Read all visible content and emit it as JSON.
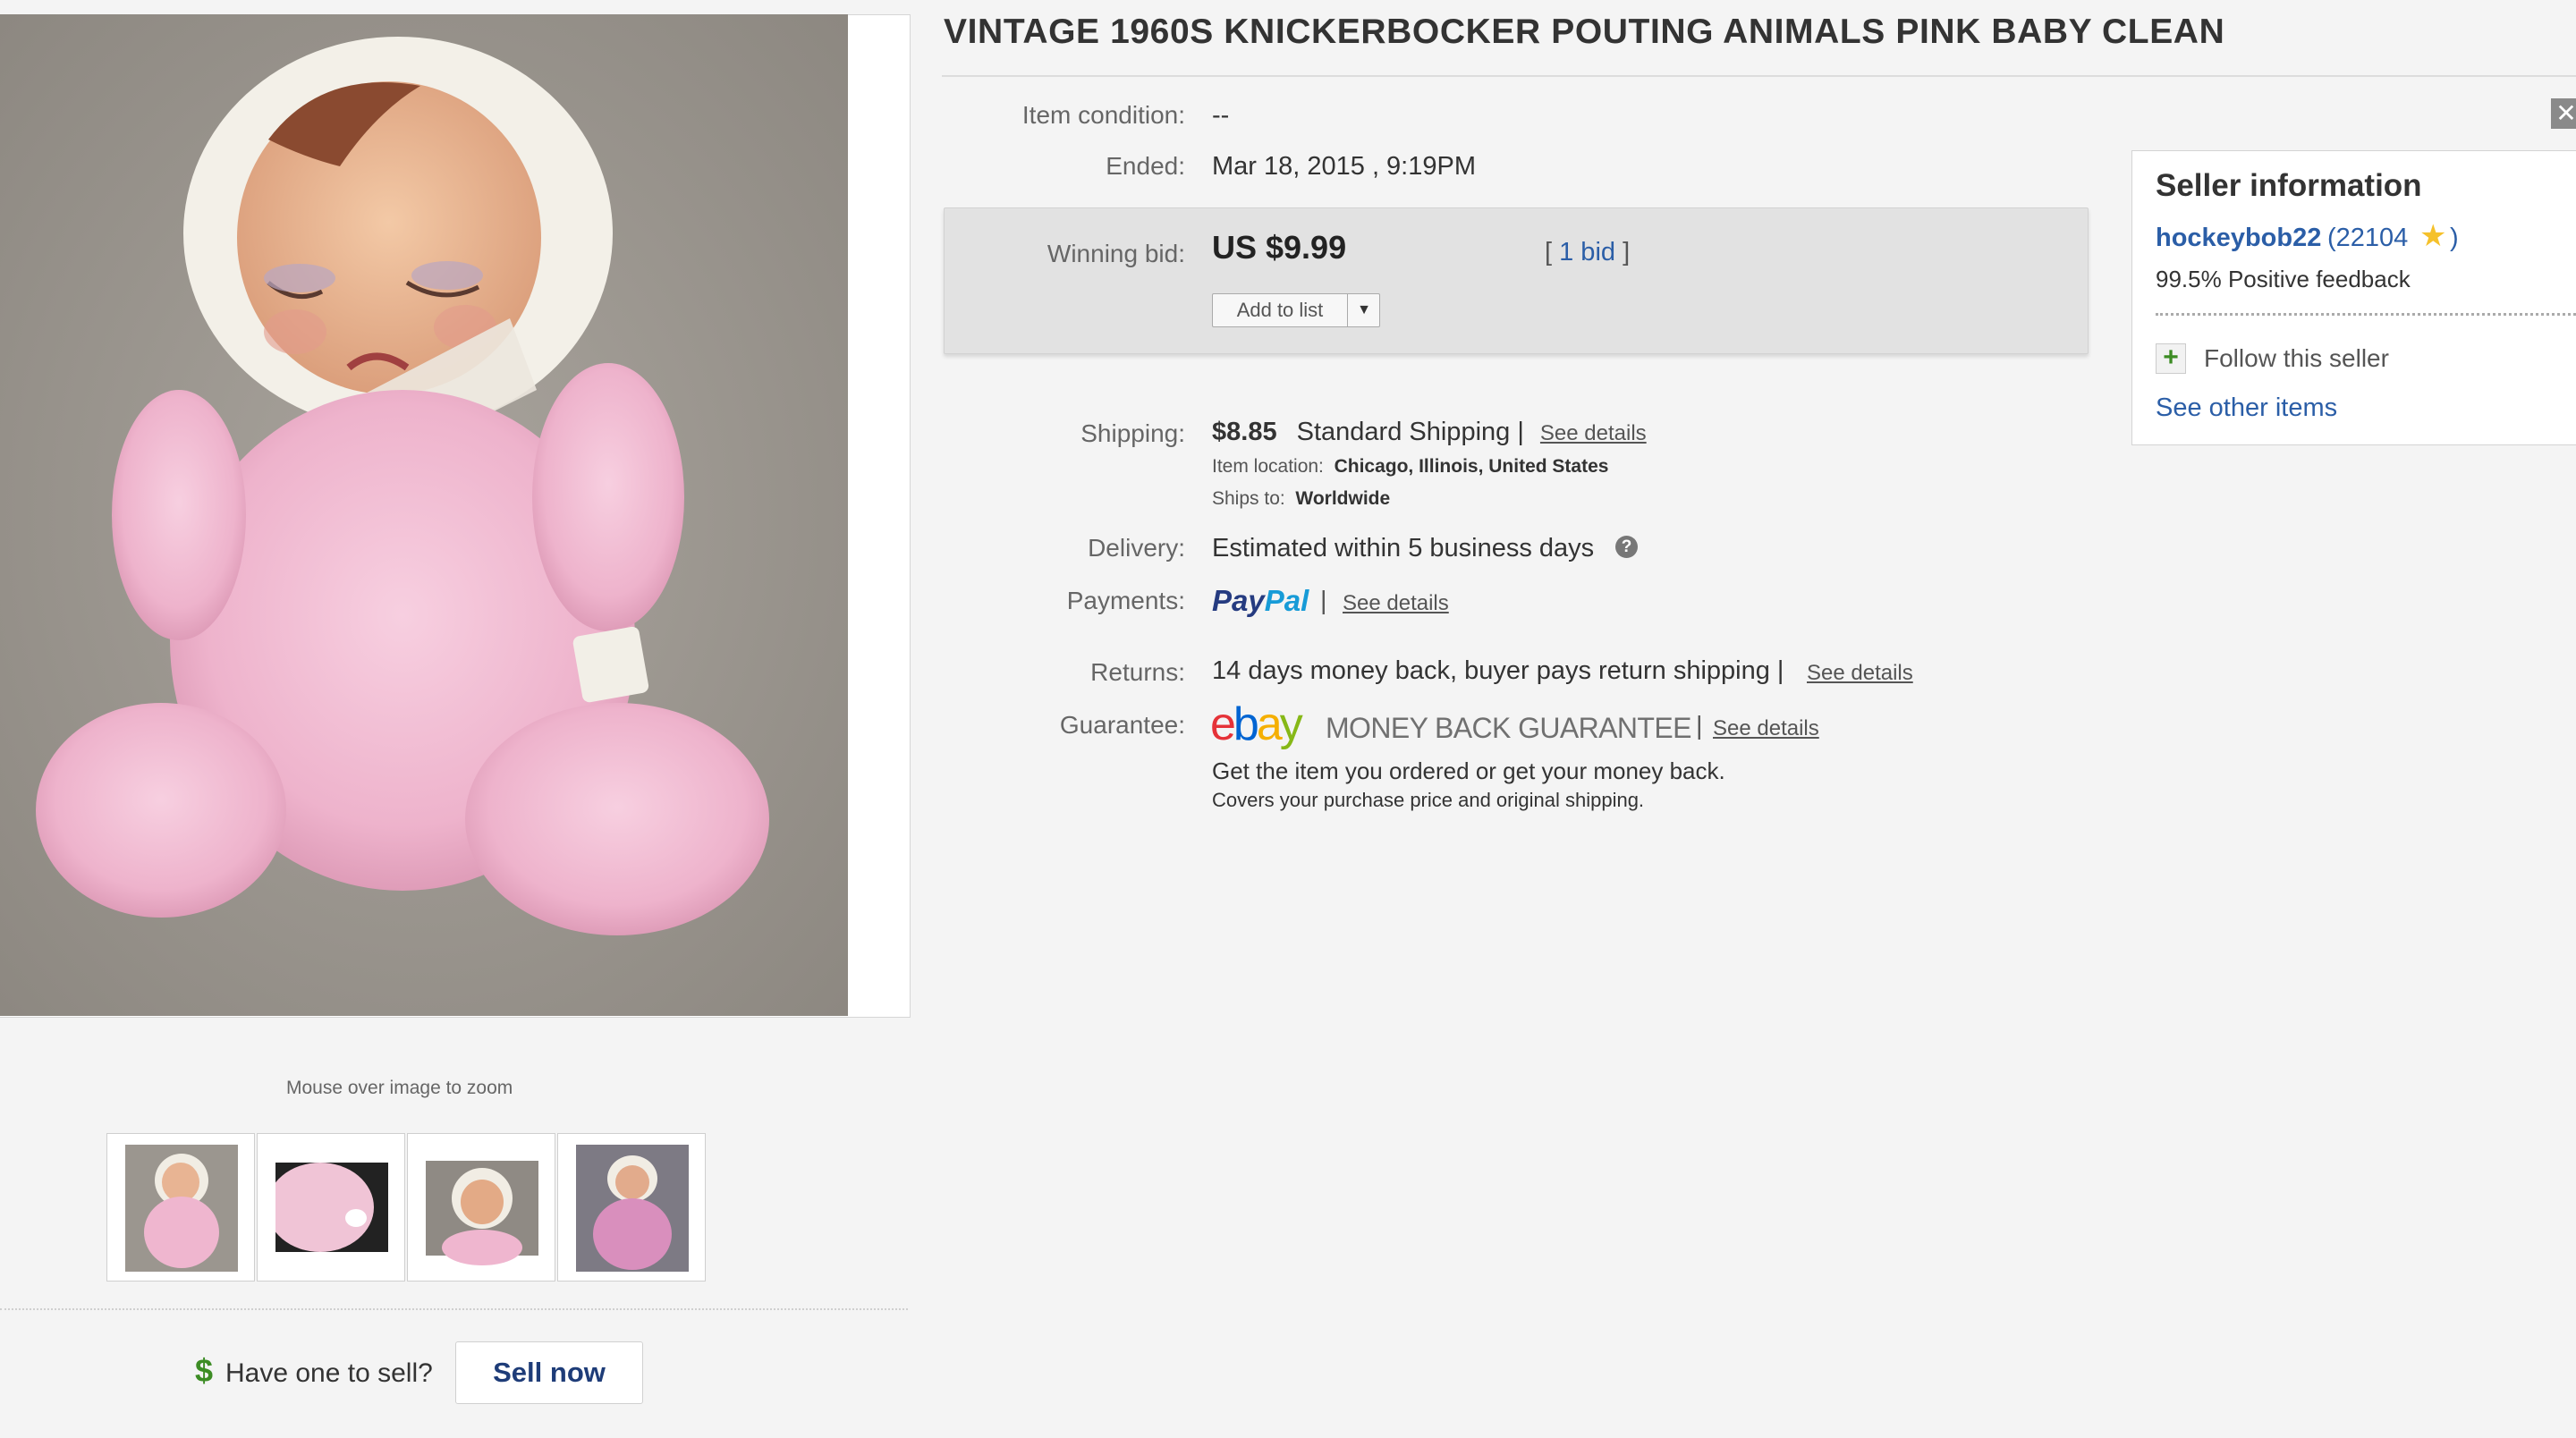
{
  "listing": {
    "title": "VINTAGE 1960S KNICKERBOCKER POUTING ANIMALS PINK BABY CLEAN",
    "zoom_hint": "Mouse over image to zoom",
    "thumbnail_count": 4
  },
  "details": {
    "condition": {
      "label": "Item condition:",
      "value": "--"
    },
    "ended": {
      "label": "Ended:",
      "value": "Mar 18, 2015 , 9:19PM"
    },
    "winning_bid": {
      "label": "Winning bid:",
      "price": "US $9.99",
      "bid_open": "[ ",
      "bid_count": "1 bid",
      "bid_close": " ]",
      "add_to_list": "Add to list",
      "dropdown_icon": "caret-down"
    },
    "shipping": {
      "label": "Shipping:",
      "cost": "$8.85",
      "method": "Standard Shipping |",
      "link": "See details",
      "location_label": "Item location:",
      "location": "Chicago, Illinois, United States",
      "ships_to_label": "Ships to:",
      "ships_to": "Worldwide"
    },
    "delivery": {
      "label": "Delivery:",
      "value": "Estimated within 5 business days",
      "help_icon": "?"
    },
    "payments": {
      "label": "Payments:",
      "logo_pay": "Pay",
      "logo_pal": "Pal",
      "separator": "|",
      "link": "See details"
    },
    "returns": {
      "label": "Returns:",
      "value": "14 days money back, buyer pays return shipping |",
      "link": "See details"
    },
    "guarantee": {
      "label": "Guarantee:",
      "logo_e": "e",
      "logo_b": "b",
      "logo_a": "a",
      "logo_y": "y",
      "text": "MONEY BACK GUARANTEE",
      "separator": "|",
      "link": "See details",
      "line1": "Get the item you ordered or get your money back.",
      "line2": "Covers your purchase price and original shipping."
    }
  },
  "seller": {
    "heading": "Seller information",
    "name": "hockeybob22",
    "score": "(22104",
    "score_close": ")",
    "feedback": "99.5% Positive feedback",
    "follow": "Follow this seller",
    "other_items": "See other items"
  },
  "sell": {
    "symbol": "$",
    "prompt": "Have one to sell?",
    "button": "Sell now"
  },
  "colors": {
    "page_bg": "#f4f4f4",
    "link_blue": "#2b5ea7",
    "ebay_red": "#e53238",
    "ebay_blue": "#0064d2",
    "ebay_yellow": "#f5af02",
    "ebay_green": "#86b817",
    "paypal_dark": "#253b80",
    "paypal_light": "#179bd7",
    "star": "#f5c12b"
  },
  "icons": {
    "close": "close-icon",
    "star": "star-icon",
    "plus": "plus-icon",
    "help": "question-icon",
    "dollar": "dollar-icon"
  }
}
